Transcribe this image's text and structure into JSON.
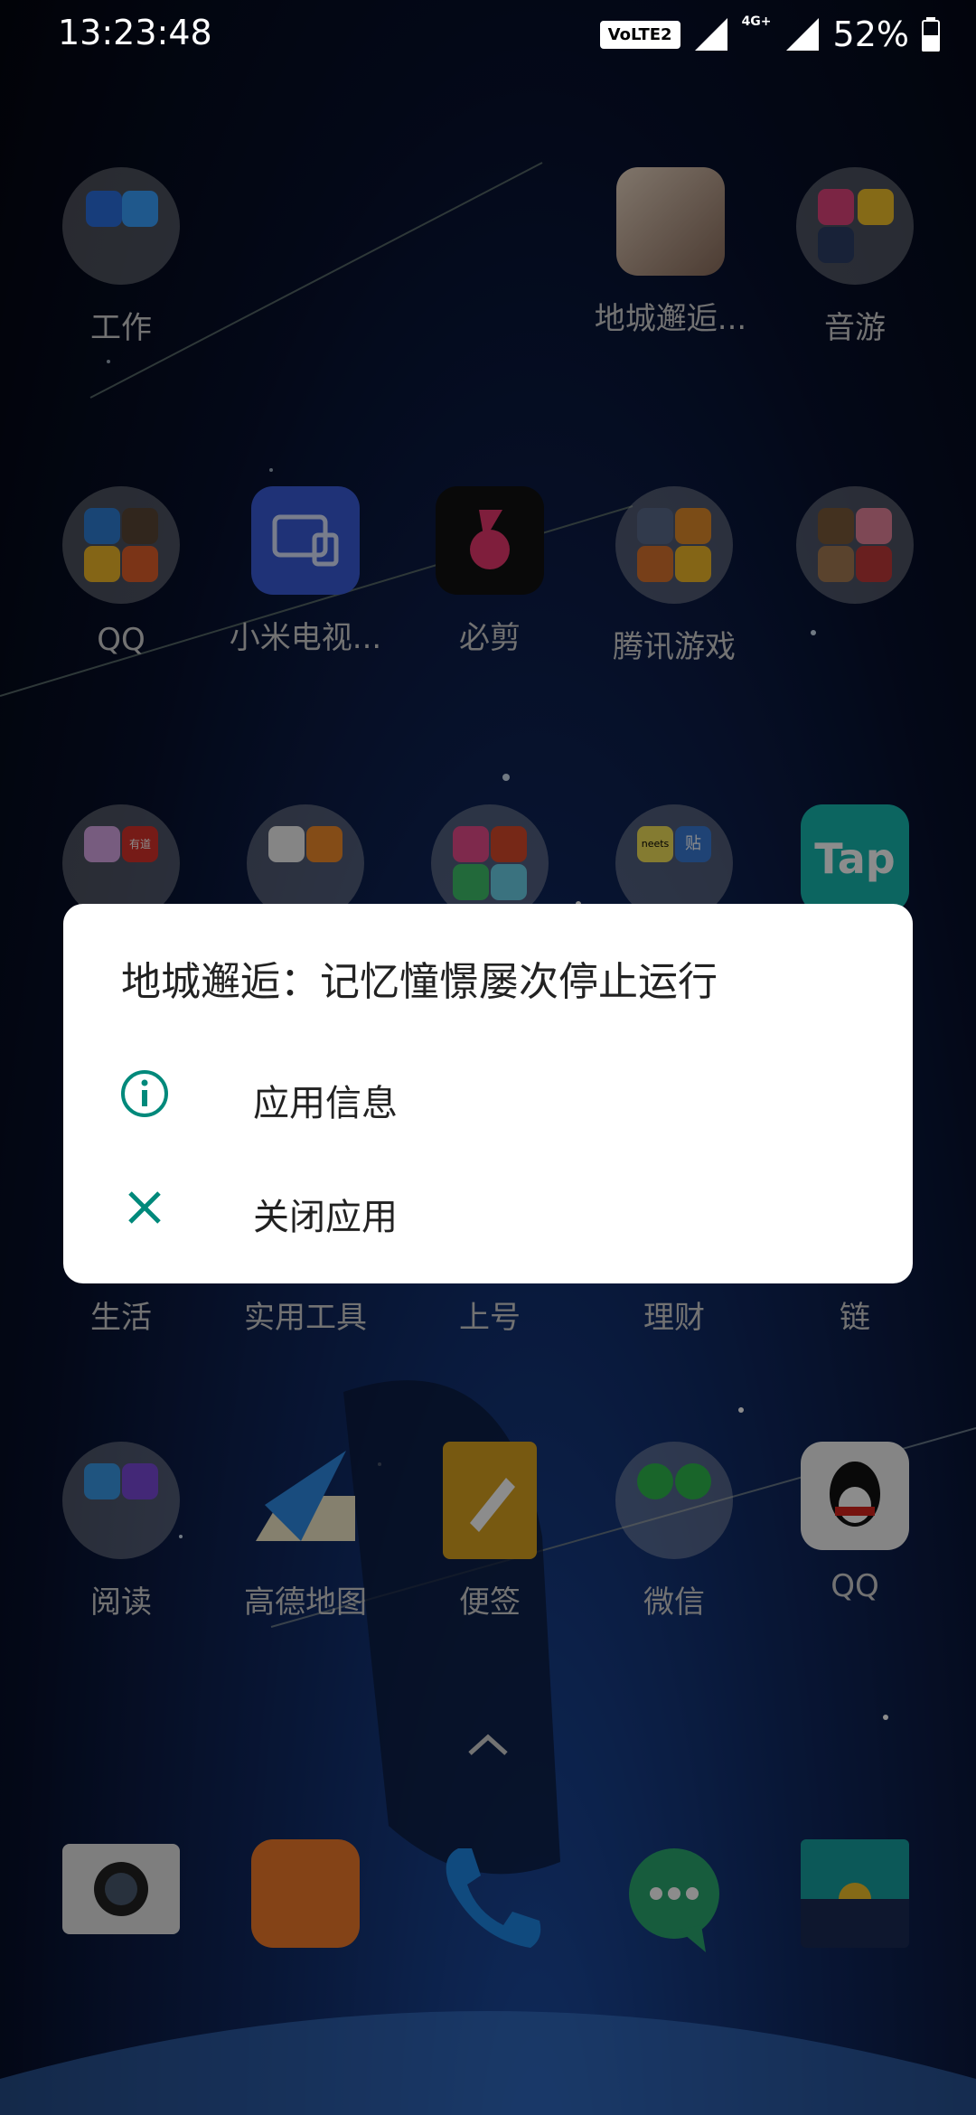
{
  "status_bar": {
    "time": "13:23:48",
    "volte": "VoLTE2",
    "network": "4G+",
    "battery": "52%"
  },
  "apps": {
    "row1": [
      {
        "label": "工作",
        "name": "folder-work"
      },
      {
        "label": "地城邂逅...",
        "name": "app-danmachi"
      },
      {
        "label": "音游",
        "name": "folder-music-games"
      }
    ],
    "row2": [
      {
        "label": "QQ",
        "name": "folder-qq"
      },
      {
        "label": "小米电视...",
        "name": "app-mi-tv"
      },
      {
        "label": "必剪",
        "name": "app-bijian"
      },
      {
        "label": "腾讯游戏",
        "name": "folder-tencent-games"
      },
      {
        "label": "",
        "name": "folder-games-2"
      }
    ],
    "row3_hidden_labels": [
      {
        "label": "生活"
      },
      {
        "label": "实用工具"
      },
      {
        "label": "上号"
      },
      {
        "label": "理财"
      },
      {
        "label": "链"
      }
    ],
    "row3_icons": {
      "tap_text": "Tap",
      "neets": "neets",
      "tie": "贴",
      "youdao": "有道"
    },
    "row4": [
      {
        "label": "阅读",
        "name": "folder-reading"
      },
      {
        "label": "高德地图",
        "name": "app-amap"
      },
      {
        "label": "便签",
        "name": "app-notes"
      },
      {
        "label": "微信",
        "name": "folder-wechat"
      },
      {
        "label": "QQ",
        "name": "app-qq"
      }
    ]
  },
  "dialog": {
    "title": "地城邂逅：记忆憧憬屡次停止运行",
    "items": [
      {
        "label": "应用信息",
        "icon": "info-icon"
      },
      {
        "label": "关闭应用",
        "icon": "close-icon"
      }
    ],
    "accent": "#00897b"
  },
  "dock": [
    {
      "name": "camera"
    },
    {
      "name": "uc-browser"
    },
    {
      "name": "phone"
    },
    {
      "name": "messages"
    },
    {
      "name": "gallery"
    }
  ]
}
